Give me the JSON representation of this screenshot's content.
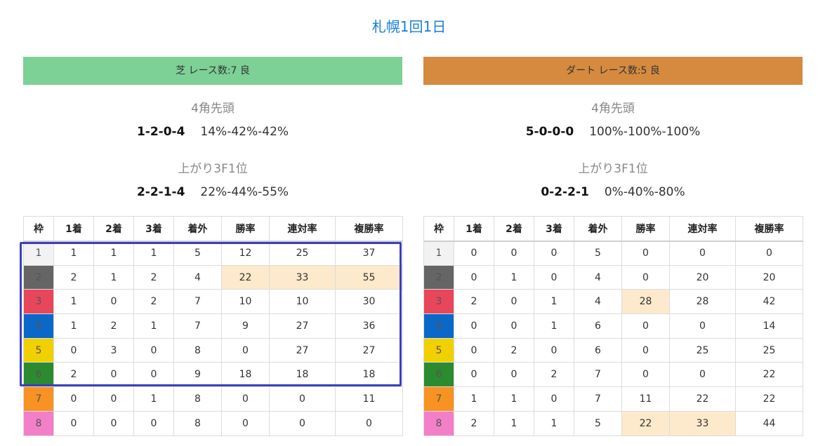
{
  "page_title": "札幌1回1日",
  "colors": {
    "title": "#1a7fd6",
    "turf_banner": "#7dd096",
    "dirt_banner": "#d68a40",
    "highlight_cell": "#fde9cb",
    "highlight_box": "#3b3fbf"
  },
  "panels": [
    {
      "banner": "芝 レース数:7 良",
      "stat1_label": "4角先頭",
      "stat1_pattern": "1-2-0-4",
      "stat1_rates": "14%-42%-42%",
      "stat2_label": "上がり3F1位",
      "stat2_pattern": "2-2-1-4",
      "stat2_rates": "22%-44%-55%",
      "headers": [
        "枠",
        "1着",
        "2着",
        "3着",
        "着外",
        "勝率",
        "連対率",
        "複勝率"
      ],
      "rows": [
        [
          "1",
          "1",
          "1",
          "1",
          "5",
          "12",
          "25",
          "37"
        ],
        [
          "2",
          "2",
          "1",
          "2",
          "4",
          "22",
          "33",
          "55"
        ],
        [
          "3",
          "1",
          "0",
          "2",
          "7",
          "10",
          "10",
          "30"
        ],
        [
          "4",
          "1",
          "2",
          "1",
          "7",
          "9",
          "27",
          "36"
        ],
        [
          "5",
          "0",
          "3",
          "0",
          "8",
          "0",
          "27",
          "27"
        ],
        [
          "6",
          "2",
          "0",
          "0",
          "9",
          "18",
          "18",
          "18"
        ],
        [
          "7",
          "0",
          "0",
          "1",
          "8",
          "0",
          "0",
          "11"
        ],
        [
          "8",
          "0",
          "0",
          "0",
          "8",
          "0",
          "0",
          "0"
        ]
      ],
      "highlighted_cells": [
        [
          1,
          5
        ],
        [
          1,
          6
        ],
        [
          1,
          7
        ]
      ]
    },
    {
      "banner": "ダート レース数:5 良",
      "stat1_label": "4角先頭",
      "stat1_pattern": "5-0-0-0",
      "stat1_rates": "100%-100%-100%",
      "stat2_label": "上がり3F1位",
      "stat2_pattern": "0-2-2-1",
      "stat2_rates": "0%-40%-80%",
      "headers": [
        "枠",
        "1着",
        "2着",
        "3着",
        "着外",
        "勝率",
        "連対率",
        "複勝率"
      ],
      "rows": [
        [
          "1",
          "0",
          "0",
          "0",
          "5",
          "0",
          "0",
          "0"
        ],
        [
          "2",
          "0",
          "1",
          "0",
          "4",
          "0",
          "20",
          "20"
        ],
        [
          "3",
          "2",
          "0",
          "1",
          "4",
          "28",
          "28",
          "42"
        ],
        [
          "4",
          "0",
          "0",
          "1",
          "6",
          "0",
          "0",
          "14"
        ],
        [
          "5",
          "0",
          "2",
          "0",
          "6",
          "0",
          "25",
          "25"
        ],
        [
          "6",
          "0",
          "0",
          "2",
          "7",
          "0",
          "0",
          "22"
        ],
        [
          "7",
          "1",
          "1",
          "0",
          "7",
          "11",
          "22",
          "22"
        ],
        [
          "8",
          "2",
          "1",
          "1",
          "5",
          "22",
          "33",
          "44"
        ]
      ],
      "highlighted_cells": [
        [
          2,
          5
        ],
        [
          7,
          5
        ],
        [
          7,
          6
        ]
      ]
    }
  ]
}
